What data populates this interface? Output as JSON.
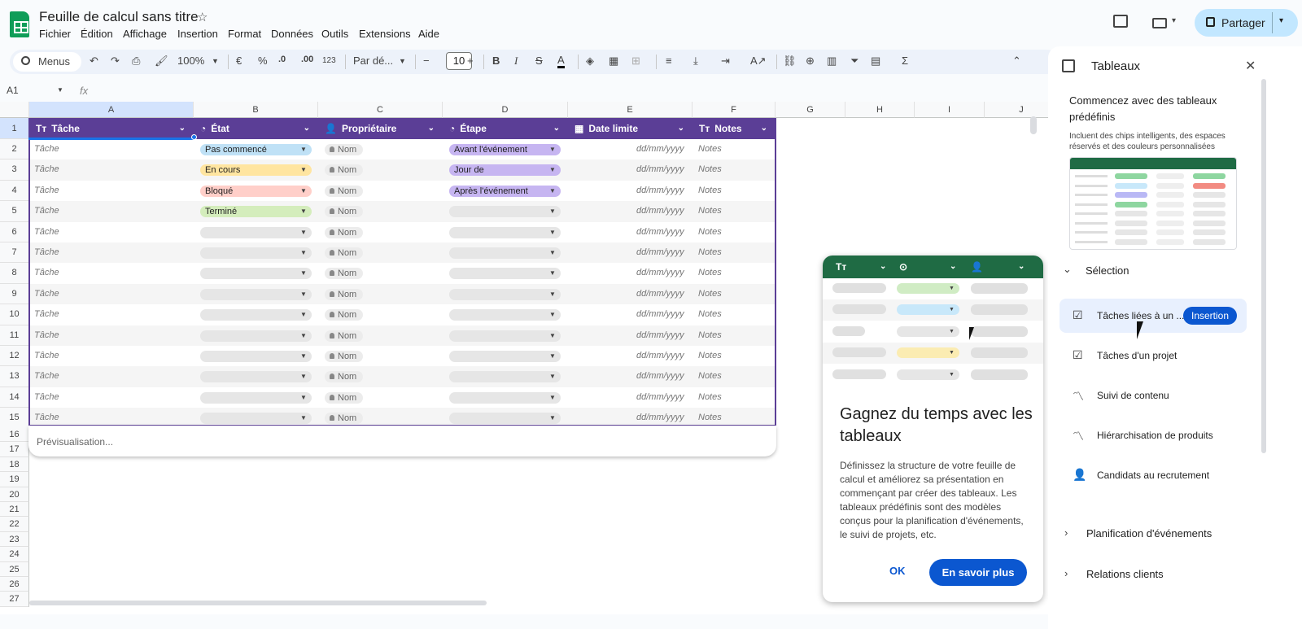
{
  "title": "Feuille de calcul sans titre",
  "menu": [
    "Fichier",
    "Édition",
    "Affichage",
    "Insertion",
    "Format",
    "Données",
    "Outils",
    "Extensions",
    "Aide"
  ],
  "share_label": "Partager",
  "toolbar": {
    "search_label": "Menus",
    "zoom": "100%",
    "currency": "€",
    "percent": "%",
    "dec_decrease": ".0",
    "dec_increase": ".00",
    "format_123": "123",
    "font": "Par dé...",
    "font_size": "10",
    "bold": "B",
    "italic": "I",
    "strike": "S",
    "text_color": "A",
    "sigma": "Σ"
  },
  "formula_bar": {
    "cell_ref": "A1",
    "fx": "fx"
  },
  "columns": [
    "A",
    "B",
    "C",
    "D",
    "E",
    "F",
    "G",
    "H",
    "I",
    "J"
  ],
  "rows": [
    "1",
    "2",
    "3",
    "4",
    "5",
    "6",
    "7",
    "8",
    "9",
    "10",
    "11",
    "12",
    "13",
    "14",
    "15",
    "16",
    "17",
    "18",
    "19",
    "20",
    "21",
    "22",
    "23",
    "24",
    "25",
    "26",
    "27"
  ],
  "table": {
    "headers": [
      {
        "icon": "Tт",
        "label": "Tâche"
      },
      {
        "icon": "◔",
        "label": "État"
      },
      {
        "icon": "👤",
        "label": "Propriétaire"
      },
      {
        "icon": "◔",
        "label": "Étape"
      },
      {
        "icon": "▦",
        "label": "Date limite"
      },
      {
        "icon": "Tт",
        "label": "Notes"
      }
    ],
    "task_placeholder": "Tâche",
    "owner_placeholder": "Nom",
    "date_placeholder": "dd/mm/yyyy",
    "notes_placeholder": "Notes",
    "status": [
      "Pas commencé",
      "En cours",
      "Bloqué",
      "Terminé",
      "",
      "",
      "",
      "",
      "",
      "",
      "",
      "",
      "",
      ""
    ],
    "status_colors": [
      "#bfe1f6",
      "#ffe5a0",
      "#ffcfc9",
      "#d4edbc"
    ],
    "stage": [
      "Avant l'événement",
      "Jour de",
      "Après l'événement",
      "",
      "",
      "",
      "",
      "",
      "",
      "",
      "",
      "",
      "",
      ""
    ],
    "stage_color": "#c6b5f1",
    "header_color": "#5b3e96",
    "preview": "Prévisualisation..."
  },
  "popup": {
    "title": "Gagnez du temps avec les tableaux",
    "body": "Définissez la structure de votre feuille de calcul et améliorez sa présentation en commençant par créer des tableaux. Les tableaux prédéfinis sont des modèles conçus pour la planification d'événements, le suivi de projets, etc.",
    "ok": "OK",
    "learn_more": "En savoir plus",
    "header_color": "#1f6b44"
  },
  "panel": {
    "title": "Tableaux",
    "heading": "Commencez avec des tableaux prédéfinis",
    "subheading": "Incluent des chips intelligents, des espaces réservés et des couleurs personnalisées",
    "section_selection": "Sélection",
    "items": [
      {
        "icon": "checklist-icon",
        "label": "Tâches liées à un ..."
      },
      {
        "icon": "checklist-icon",
        "label": "Tâches d'un projet"
      },
      {
        "icon": "trend-icon",
        "label": "Suivi de contenu"
      },
      {
        "icon": "trend-icon",
        "label": "Hiérarchisation de produits"
      },
      {
        "icon": "person-icon",
        "label": "Candidats au recrutement"
      }
    ],
    "insert_label": "Insertion",
    "section_events": "Planification d'événements",
    "section_clients": "Relations clients"
  }
}
